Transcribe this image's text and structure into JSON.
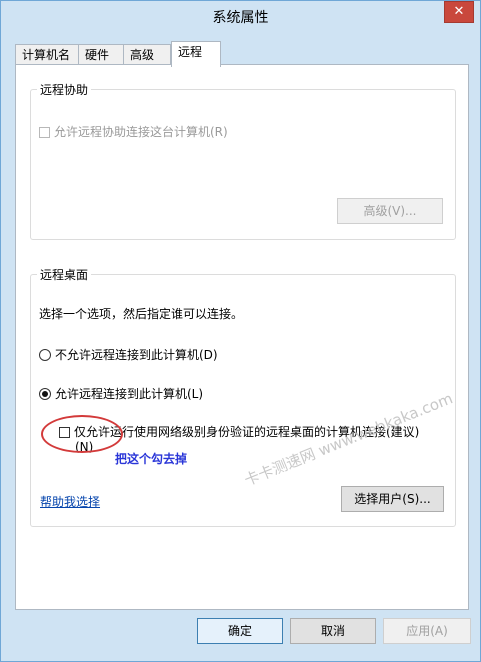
{
  "window": {
    "title": "系统属性",
    "close_glyph": "✕"
  },
  "tabs": [
    {
      "label": "计算机名"
    },
    {
      "label": "硬件"
    },
    {
      "label": "高级"
    },
    {
      "label": "远程",
      "active": true
    }
  ],
  "remote_assistance": {
    "title": "远程协助",
    "checkbox_label": "允许远程协助连接这台计算机(R)",
    "advanced_button": "高级(V)..."
  },
  "remote_desktop": {
    "title": "远程桌面",
    "instruction": "选择一个选项，然后指定谁可以连接。",
    "option_deny": "不允许远程连接到此计算机(D)",
    "option_allow": "允许远程连接到此计算机(L)",
    "nla_checkbox_line1": "仅允许运行使用网络级别身份验证的远程桌面的计算机连接(建议)",
    "nla_checkbox_line2": "(N)",
    "help_link": "帮助我选择",
    "select_users_button": "选择用户(S)..."
  },
  "annotation": "把这个勾去掉",
  "watermark": "卡卡测速网 www.webkaka.com",
  "footer": {
    "ok": "确定",
    "cancel": "取消",
    "apply": "应用(A)"
  },
  "colors": {
    "title_bar": "#cfe3f3",
    "close": "#c9483c",
    "annotation": "#2a36d8",
    "highlight_circle": "#d33a3a"
  }
}
